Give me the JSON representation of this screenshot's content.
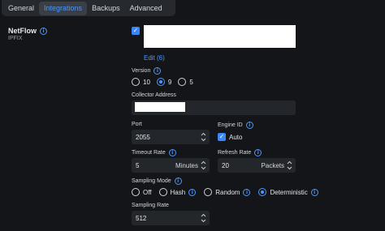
{
  "tabs": [
    {
      "label": "General"
    },
    {
      "label": "Integrations"
    },
    {
      "label": "Backups"
    },
    {
      "label": "Advanced"
    }
  ],
  "section": {
    "title": "NetFlow",
    "subtitle": "IPFIX"
  },
  "edit_link": "Edit (6)",
  "version": {
    "label": "Version",
    "options": [
      "10",
      "9",
      "5"
    ],
    "selected": "9"
  },
  "collector": {
    "label": "Collector Address"
  },
  "port": {
    "label": "Port",
    "value": "2055"
  },
  "engine_id": {
    "label": "Engine ID",
    "auto_label": "Auto"
  },
  "timeout_rate": {
    "label": "Timeout Rate",
    "value": "5",
    "unit": "Minutes"
  },
  "refresh_rate": {
    "label": "Refresh Rate",
    "value": "20",
    "unit": "Packets"
  },
  "sampling_mode": {
    "label": "Sampling Mode",
    "options": [
      "Off",
      "Hash",
      "Random",
      "Deterministic"
    ],
    "selected": "Deterministic"
  },
  "sampling_rate": {
    "label": "Sampling Rate",
    "value": "512"
  },
  "colors": {
    "accent": "#4c97ff",
    "background": "#131518",
    "field": "#23262b"
  }
}
